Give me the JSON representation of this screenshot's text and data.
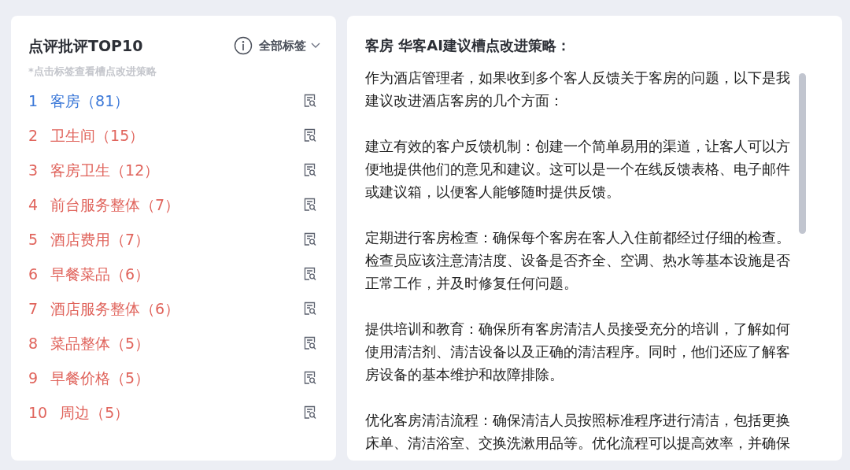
{
  "tags_panel": {
    "title": "点评批评TOP10",
    "filter": {
      "label": "全部标签"
    },
    "hint": "*点击标签查看槽点改进策略",
    "items": [
      {
        "rank": "1",
        "label": "客房（81）",
        "selected": true
      },
      {
        "rank": "2",
        "label": "卫生间（15）",
        "selected": false
      },
      {
        "rank": "3",
        "label": "客房卫生（12）",
        "selected": false
      },
      {
        "rank": "4",
        "label": "前台服务整体（7）",
        "selected": false
      },
      {
        "rank": "5",
        "label": "酒店费用（7）",
        "selected": false
      },
      {
        "rank": "6",
        "label": "早餐菜品（6）",
        "selected": false
      },
      {
        "rank": "7",
        "label": "酒店服务整体（6）",
        "selected": false
      },
      {
        "rank": "8",
        "label": "菜品整体（5）",
        "selected": false
      },
      {
        "rank": "9",
        "label": "早餐价格（5）",
        "selected": false
      },
      {
        "rank": "10",
        "label": "周边（5）",
        "selected": false
      }
    ]
  },
  "advice_panel": {
    "title": "客房 华客AI建议槽点改进策略：",
    "paragraphs": [
      "作为酒店管理者，如果收到多个客人反馈关于客房的问题，以下是我建议改进酒店客房的几个方面：",
      "建立有效的客户反馈机制：创建一个简单易用的渠道，让客人可以方便地提供他们的意见和建议。这可以是一个在线反馈表格、电子邮件或建议箱，以便客人能够随时提供反馈。",
      "定期进行客房检查：确保每个客房在客人入住前都经过仔细的检查。检查员应该注意清洁度、设备是否齐全、空调、热水等基本设施是否正常工作，并及时修复任何问题。",
      "提供培训和教育：确保所有客房清洁人员接受充分的培训，了解如何使用清洁剂、清洁设备以及正确的清洁程序。同时，他们还应了解客房设备的基本维护和故障排除。",
      "优化客房清洁流程：确保清洁人员按照标准程序进行清洁，包括更换床单、清洁浴室、交换洗漱用品等。优化流程可以提高效率，并确保"
    ]
  }
}
